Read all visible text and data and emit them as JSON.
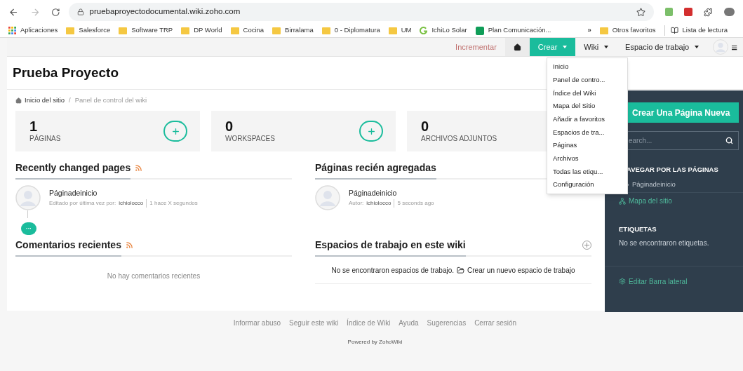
{
  "browser": {
    "url": "pruebaproyectodocumental.wiki.zoho.com",
    "bookmarks": [
      {
        "label": "Aplicaciones",
        "kind": "apps"
      },
      {
        "label": "Salesforce",
        "kind": "folder"
      },
      {
        "label": "Software TRP",
        "kind": "folder"
      },
      {
        "label": "DP World",
        "kind": "folder"
      },
      {
        "label": "Cocina",
        "kind": "folder"
      },
      {
        "label": "Birralama",
        "kind": "folder"
      },
      {
        "label": "0 - Diplomatura",
        "kind": "folder"
      },
      {
        "label": "UM",
        "kind": "folder"
      },
      {
        "label": "IchiLo Solar",
        "kind": "site"
      },
      {
        "label": "Plan Comunicación...",
        "kind": "sheet"
      }
    ],
    "overflow": "»",
    "other_bookmarks": "Otros favoritos",
    "reading_list": "Lista de lectura"
  },
  "nav": {
    "items": [
      {
        "label": "Incrementar",
        "kind": "link",
        "selected": false
      },
      {
        "kind": "home",
        "selected": false
      },
      {
        "label": "Crear",
        "kind": "menu",
        "selected": true
      },
      {
        "label": "Wiki",
        "kind": "menu",
        "selected": false
      },
      {
        "label": "Espacio de trabajo",
        "kind": "menu",
        "selected": false
      }
    ],
    "menu_icon": "≡"
  },
  "dropdown": [
    "Inicio",
    "Panel de contro...",
    "Índice del Wiki",
    "Mapa del Sitio",
    "Añadir a favoritos",
    "Espacios de tra...",
    "Páginas",
    "Archivos",
    "Todas las etiqu...",
    "Configuración"
  ],
  "title": "Prueba Proyecto",
  "breadcrumb": {
    "home": "Inicio del sitio",
    "separator": "/",
    "current": "Panel de control del wiki"
  },
  "stats": [
    {
      "count": "1",
      "label": "PÁGINAS"
    },
    {
      "count": "0",
      "label": "WORKSPACES"
    },
    {
      "count": "0",
      "label": "ARCHIVOS ADJUNTOS"
    }
  ],
  "recently_changed": {
    "title": "Recently changed pages",
    "page": "Páginadeinicio",
    "meta_prefix": "Editado por última vez por:",
    "user": "ichiolocco",
    "time": "1 hace X segundos",
    "more": "···"
  },
  "recently_added": {
    "title": "Páginas recién agregadas",
    "page": "Páginadeinicio",
    "meta_prefix": "Autor:",
    "user": "ichiolocco",
    "time": "5 seconds ago"
  },
  "comments": {
    "title": "Comentarios recientes",
    "empty": "No hay comentarios recientes"
  },
  "workspaces": {
    "title": "Espacios de trabajo en este wiki",
    "empty": "No se encontraron espacios de trabajo.",
    "create": "Crear un nuevo espacio de trabajo"
  },
  "sidebar": {
    "new_page": "Crear Una Página Nueva",
    "search_placeholder": "earch...",
    "browse_title": "AVEGAR POR LAS PÁGINAS",
    "pages": [
      "Páginadeinicio"
    ],
    "sitemap": "Mapa del sitio",
    "tags_title": "ETIQUETAS",
    "tags_empty": "No se encontraron etiquetas.",
    "edit": "Editar Barra lateral"
  },
  "footer": {
    "links": [
      "Informar abuso",
      "Seguir este wiki",
      "Índice de Wiki",
      "Ayuda",
      "Sugerencias",
      "Cerrar sesión"
    ],
    "powered": "Powered by ZohoWiki"
  }
}
